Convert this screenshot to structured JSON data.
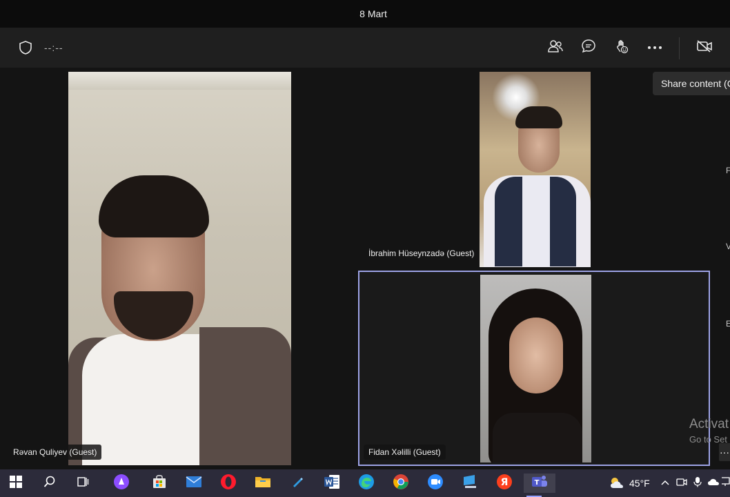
{
  "window": {
    "title": "8 Mart"
  },
  "toolbar": {
    "timer": "--:--",
    "icons": [
      "shield-icon",
      "people-icon",
      "chat-icon",
      "raise-hand-icon",
      "more-icon",
      "camera-off-icon"
    ]
  },
  "tooltip": {
    "text": "Share content (C"
  },
  "participants": [
    {
      "name": "Rəvan Quliyev (Guest)"
    },
    {
      "name": "İbrahim Hüseynzadə (Guest)"
    },
    {
      "name": "Fidan Xəlilli (Guest)"
    }
  ],
  "side_letters": [
    "F",
    "V",
    "E"
  ],
  "watermark": {
    "line1": "Activat",
    "line2": "Go to Set"
  },
  "more_dots": "···",
  "taskbar": {
    "weather_temp": "45°F",
    "apps": [
      "start",
      "search",
      "task-view",
      "alice",
      "store",
      "mail",
      "opera",
      "explorer",
      "pen",
      "word",
      "edge",
      "chrome",
      "zoom",
      "computer",
      "yandex",
      "teams"
    ],
    "colors": {
      "accent": "#9aa4ff",
      "frame": "#9da3e6"
    }
  }
}
